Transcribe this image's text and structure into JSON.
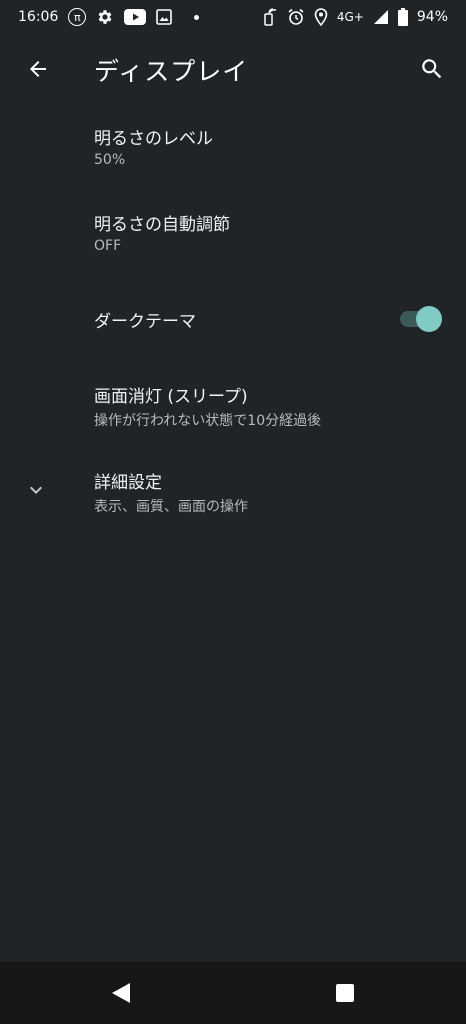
{
  "status_bar": {
    "time": "16:06",
    "network": "4G+",
    "battery": "94%",
    "icons_left": [
      "pi-icon",
      "gear-icon",
      "youtube-icon",
      "gallery-icon",
      "notification-dot"
    ],
    "icons_right": [
      "nfc-icon",
      "alarm-icon",
      "location-icon",
      "signal-icon",
      "battery-icon"
    ],
    "pi_glyph": "π"
  },
  "app_bar": {
    "title": "ディスプレイ",
    "back_icon": "arrow-left-icon",
    "search_icon": "search-icon"
  },
  "settings": {
    "brightness_level": {
      "title": "明るさのレベル",
      "summary": "50%"
    },
    "adaptive_brightness": {
      "title": "明るさの自動調節",
      "summary": "OFF"
    },
    "dark_theme": {
      "title": "ダークテーマ",
      "enabled": true
    },
    "screen_timeout": {
      "title": "画面消灯 (スリープ)",
      "summary": "操作が行われない状態で10分経過後"
    },
    "advanced": {
      "title": "詳細設定",
      "summary": "表示、画質、画面の操作",
      "icon": "chevron-down-icon"
    }
  },
  "nav_bar": {
    "back_icon": "triangle-back-icon",
    "recents_icon": "square-recents-icon"
  },
  "colors": {
    "background": "#202427",
    "accent": "#80cbc4",
    "toggle_track": "#3b5a59",
    "nav_bar": "#151718"
  }
}
